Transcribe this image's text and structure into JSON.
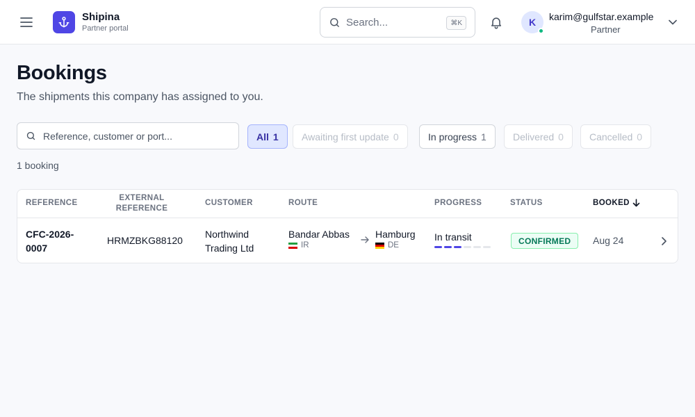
{
  "app": {
    "name": "Shipina",
    "subtitle": "Partner portal"
  },
  "header": {
    "search_placeholder": "Search...",
    "search_shortcut": "⌘K",
    "user": {
      "initial": "K",
      "email": "karim@gulfstar.example",
      "role": "Partner",
      "status_color": "#10b981"
    }
  },
  "page": {
    "title": "Bookings",
    "subtitle": "The shipments this company has assigned to you.",
    "filter_placeholder": "Reference, customer or port...",
    "result_count": "1 booking"
  },
  "filters": [
    {
      "label": "All",
      "count": "1",
      "state": "active"
    },
    {
      "label": "Awaiting first update",
      "count": "0",
      "state": "muted"
    },
    {
      "label": "In progress",
      "count": "1",
      "state": "normal"
    },
    {
      "label": "Delivered",
      "count": "0",
      "state": "muted"
    },
    {
      "label": "Cancelled",
      "count": "0",
      "state": "muted"
    }
  ],
  "table": {
    "columns": {
      "reference": "REFERENCE",
      "external_reference": "EXTERNAL REFERENCE",
      "customer": "CUSTOMER",
      "route": "ROUTE",
      "progress": "PROGRESS",
      "status": "STATUS",
      "booked": "BOOKED"
    },
    "rows": [
      {
        "reference": "CFC-2026-0007",
        "external_reference": "HRMZBKG88120",
        "customer": "Northwind Trading Ltd",
        "origin": {
          "port": "Bandar Abbas",
          "country": "IR"
        },
        "destination": {
          "port": "Hamburg",
          "country": "DE"
        },
        "progress": {
          "label": "In transit",
          "completed_steps": 3,
          "total_steps": 6
        },
        "status": "CONFIRMED",
        "booked": "Aug 24"
      }
    ]
  },
  "colors": {
    "accent": "#4f46e5",
    "status_confirmed": "#047857"
  }
}
